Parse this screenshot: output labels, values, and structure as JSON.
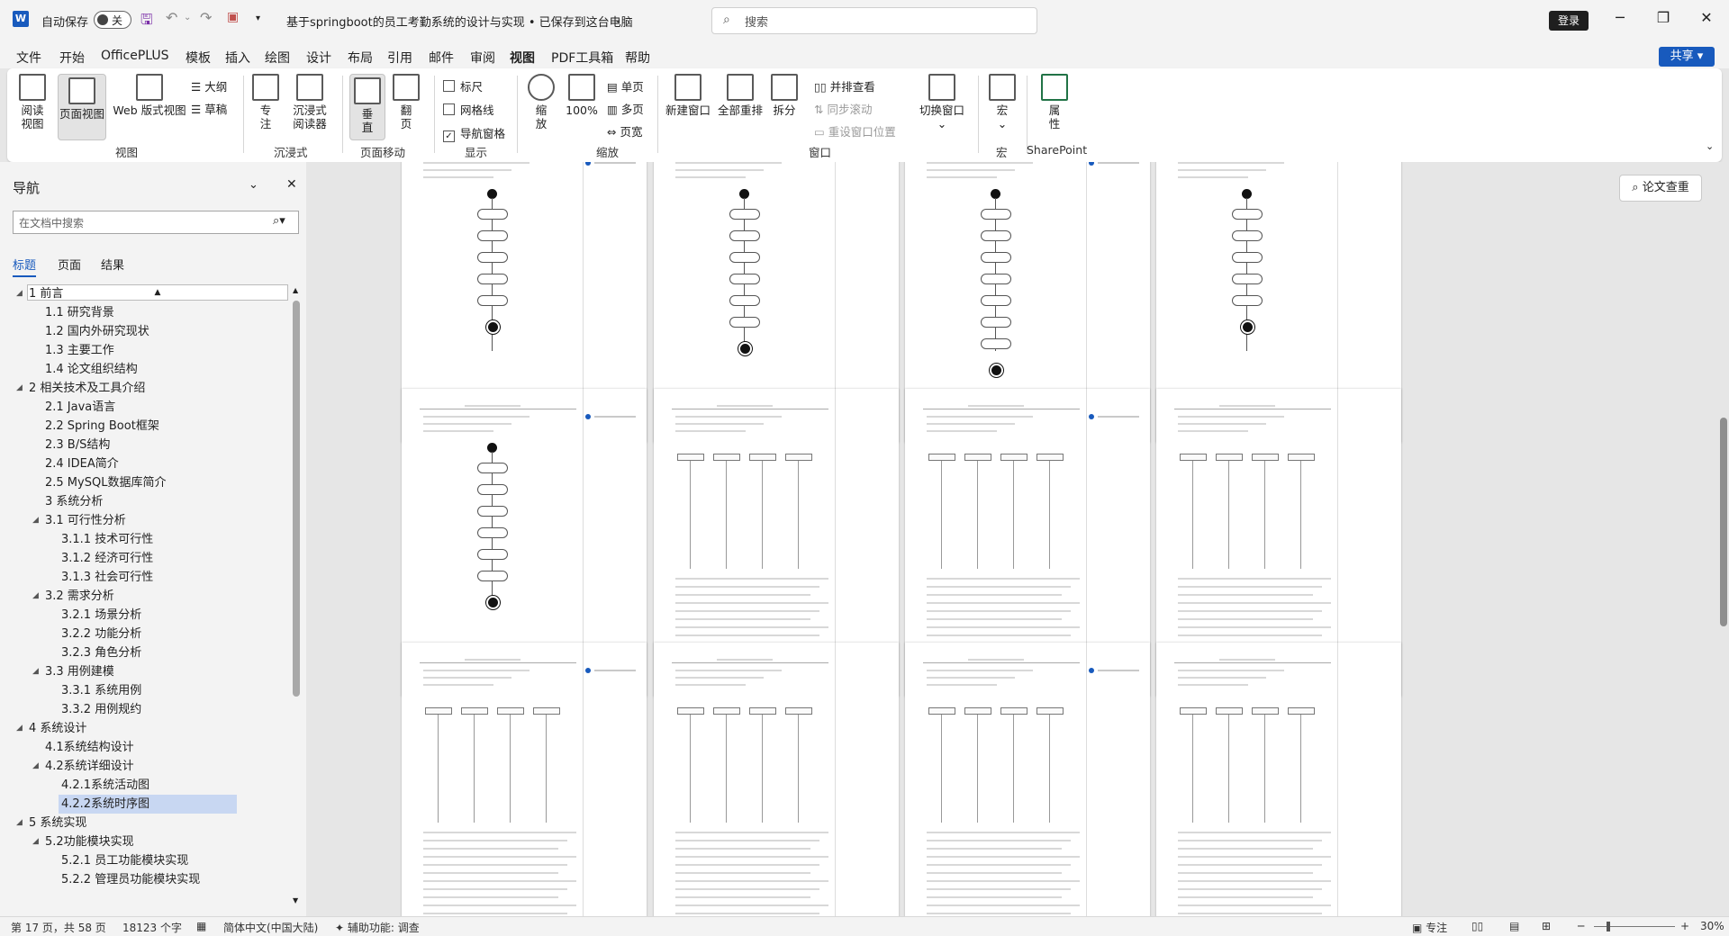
{
  "titlebar": {
    "autosave_label": "自动保存",
    "autosave_state": "关",
    "doc_title": "基于springboot的员工考勤系统的设计与实现 • 已保存到这台电脑",
    "search_placeholder": "搜索",
    "login_label": "登录",
    "share_label": "共享"
  },
  "menu": [
    "文件",
    "开始",
    "OfficePLUS",
    "模板",
    "插入",
    "绘图",
    "设计",
    "布局",
    "引用",
    "邮件",
    "审阅",
    "视图",
    "PDF工具箱",
    "帮助"
  ],
  "ribbon": {
    "views": {
      "read": "阅读\n视图",
      "page": "页面视图",
      "web": "Web 版式视图",
      "outline": "大纲",
      "draft": "草稿",
      "group": "视图"
    },
    "immersive": {
      "focus": "专\n注",
      "reader": "沉浸式\n阅读器",
      "group": "沉浸式"
    },
    "page_move": {
      "vertical": "垂\n直",
      "side": "翻\n页",
      "group": "页面移动"
    },
    "show": {
      "ruler": "标尺",
      "gridlines": "网格线",
      "nav_pane": "导航窗格",
      "group": "显示"
    },
    "zoom": {
      "zoom": "缩\n放",
      "percent": "100%",
      "single": "单页",
      "multi": "多页",
      "width": "页宽",
      "group": "缩放"
    },
    "window": {
      "new": "新建窗口",
      "arrange": "全部重排",
      "split": "拆分",
      "side_by_side": "并排查看",
      "sync_scroll": "同步滚动",
      "reset_pos": "重设窗口位置",
      "switch": "切换窗口",
      "group": "窗口"
    },
    "macros": {
      "macro": "宏",
      "group": "宏"
    },
    "sharepoint": {
      "props": "属\n性",
      "group": "SharePoint"
    }
  },
  "nav": {
    "title": "导航",
    "search_placeholder": "在文档中搜索",
    "tabs": [
      "标题",
      "页面",
      "结果"
    ],
    "items": [
      {
        "label": "1 前言",
        "level": 1
      },
      {
        "label": "1.1 研究背景",
        "level": 2
      },
      {
        "label": "1.2 国内外研究现状",
        "level": 2
      },
      {
        "label": "1.3 主要工作",
        "level": 2
      },
      {
        "label": "1.4 论文组织结构",
        "level": 2
      },
      {
        "label": "2 相关技术及工具介绍",
        "level": 1
      },
      {
        "label": "2.1 Java语言",
        "level": 2
      },
      {
        "label": "2.2 Spring Boot框架",
        "level": 2
      },
      {
        "label": "2.3 B/S结构",
        "level": 2
      },
      {
        "label": "2.4 IDEA简介",
        "level": 2
      },
      {
        "label": "2.5 MySQL数据库简介",
        "level": 2
      },
      {
        "label": "3  系统分析",
        "level": 2
      },
      {
        "label": "3.1 可行性分析",
        "level": 2
      },
      {
        "label": "3.1.1 技术可行性",
        "level": 3
      },
      {
        "label": "3.1.2 经济可行性",
        "level": 3
      },
      {
        "label": "3.1.3 社会可行性",
        "level": 3
      },
      {
        "label": "3.2 需求分析",
        "level": 2
      },
      {
        "label": "3.2.1 场景分析",
        "level": 3
      },
      {
        "label": "3.2.2 功能分析",
        "level": 3
      },
      {
        "label": "3.2.3 角色分析",
        "level": 3
      },
      {
        "label": "3.3 用例建模",
        "level": 2
      },
      {
        "label": "3.3.1 系统用例",
        "level": 3
      },
      {
        "label": "3.3.2 用例规约",
        "level": 3
      },
      {
        "label": "4 系统设计",
        "level": 1
      },
      {
        "label": "4.1系统结构设计",
        "level": 2
      },
      {
        "label": "4.2系统详细设计",
        "level": 2
      },
      {
        "label": "4.2.1系统活动图",
        "level": 3
      },
      {
        "label": "4.2.2系统时序图",
        "level": 3,
        "selected": true
      },
      {
        "label": "5 系统实现",
        "level": 1
      },
      {
        "label": "5.2功能模块实现",
        "level": 2
      },
      {
        "label": "5.2.1 员工功能模块实现",
        "level": 3
      },
      {
        "label": "5.2.2 管理员功能模块实现",
        "level": 3
      }
    ]
  },
  "doc": {
    "essay_check": "论文查重"
  },
  "status": {
    "page": "第 17 页，共 58 页",
    "words": "18123 个字",
    "language": "简体中文(中国大陆)",
    "accessibility": "辅助功能: 调查",
    "focus": "专注",
    "zoom": "30%"
  }
}
